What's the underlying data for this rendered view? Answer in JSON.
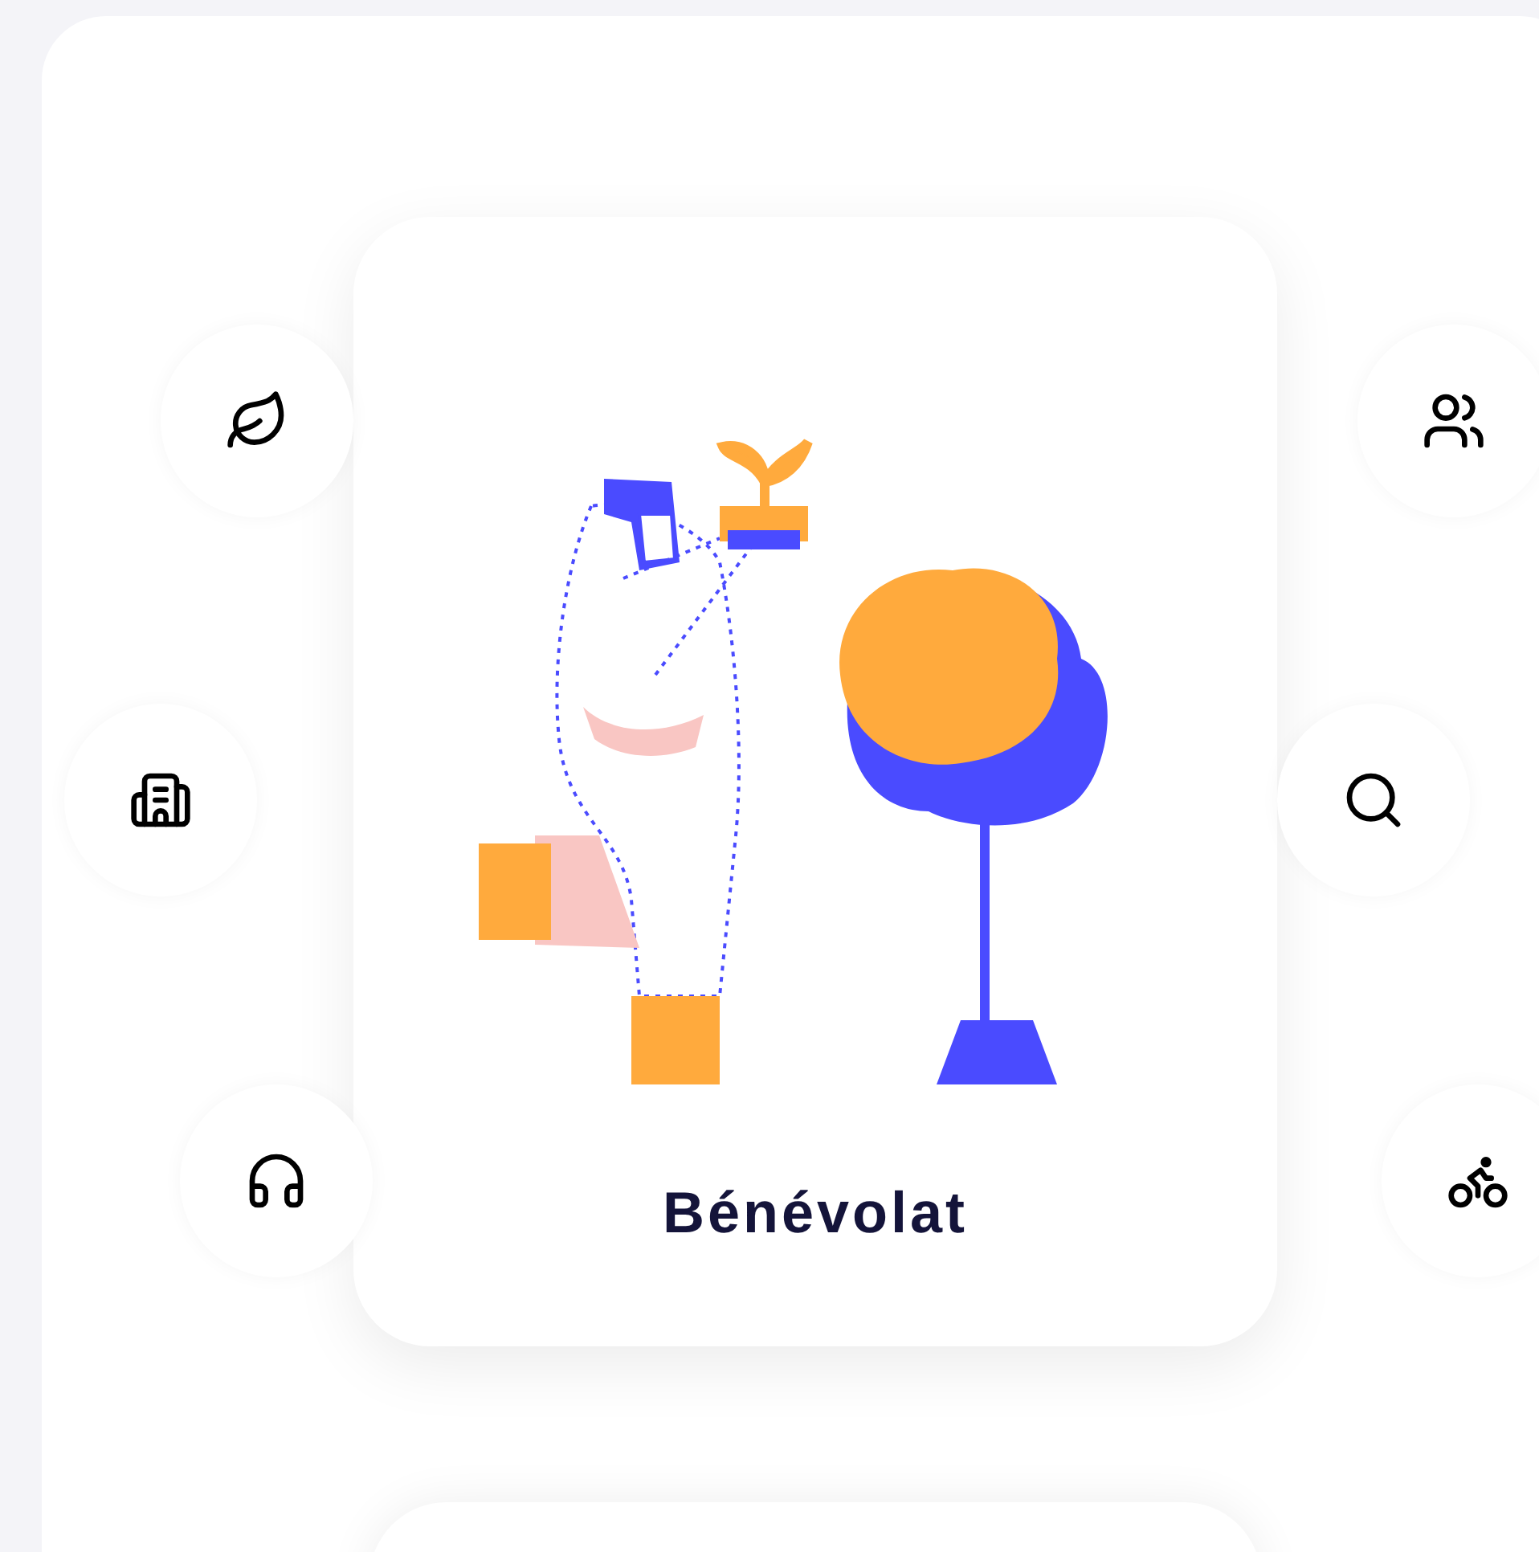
{
  "card": {
    "title": "Bénévolat"
  }
}
